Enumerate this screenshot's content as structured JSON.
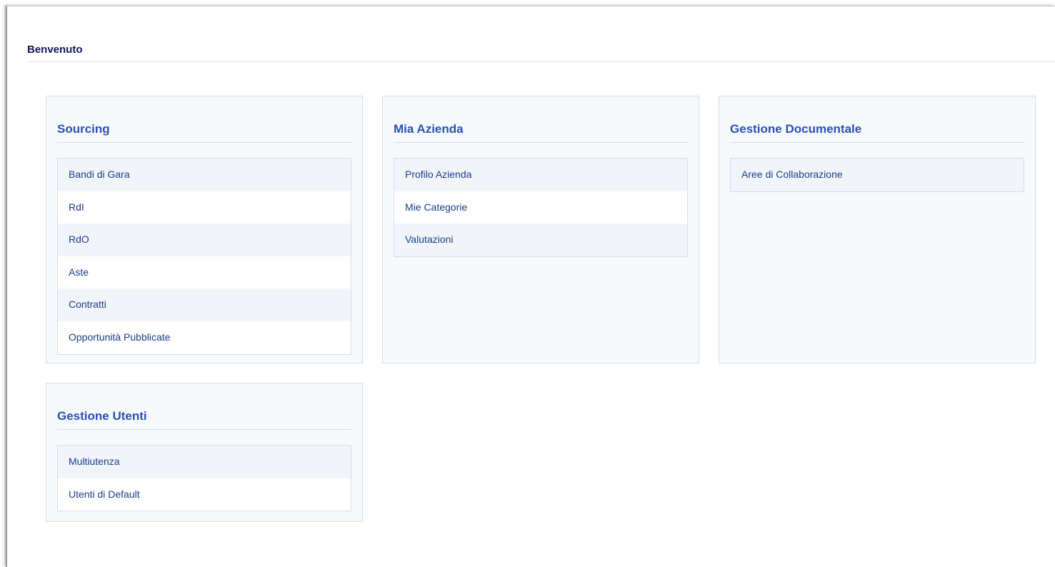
{
  "page": {
    "title": "Benvenuto"
  },
  "panels": {
    "sourcing": {
      "title": "Sourcing",
      "items": [
        "Bandi di Gara",
        "RdI",
        "RdO",
        "Aste",
        "Contratti",
        "Opportunità Pubblicate"
      ]
    },
    "mia_azienda": {
      "title": "Mia Azienda",
      "items": [
        "Profilo Azienda",
        "Mie Categorie",
        "Valutazioni"
      ]
    },
    "gestione_documentale": {
      "title": "Gestione Documentale",
      "items": [
        "Aree di Collaborazione"
      ]
    },
    "gestione_utenti": {
      "title": "Gestione Utenti",
      "items": [
        "Multiutenza",
        "Utenti di Default"
      ]
    }
  },
  "colors": {
    "heading": "#2a4fb7",
    "link": "#1c3b8c",
    "title": "#13135e",
    "panel_bg": "#f7fafd",
    "border": "#d4dce6"
  }
}
